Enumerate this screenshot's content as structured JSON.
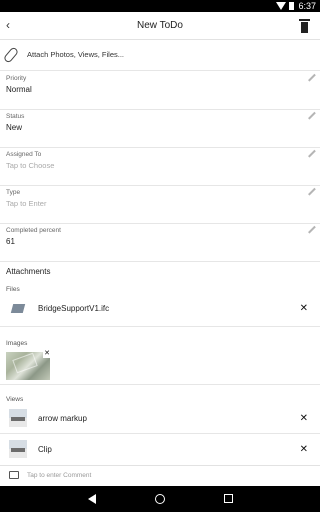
{
  "status_bar": {
    "time": "6:37"
  },
  "header": {
    "title": "New ToDo",
    "back_glyph": "‹"
  },
  "attach": {
    "label": "Attach Photos, Views, Files..."
  },
  "fields": [
    {
      "label": "Priority",
      "value": "Normal",
      "placeholder": false
    },
    {
      "label": "Status",
      "value": "New",
      "placeholder": false
    },
    {
      "label": "Assigned To",
      "value": "Tap to Choose",
      "placeholder": true
    },
    {
      "label": "Type",
      "value": "Tap to Enter",
      "placeholder": true
    },
    {
      "label": "Completed percent",
      "value": "61",
      "placeholder": false
    }
  ],
  "attachments": {
    "title": "Attachments",
    "files_title": "Files",
    "files": [
      {
        "name": "BridgeSupportV1.ifc"
      }
    ],
    "images_title": "Images",
    "views_title": "Views",
    "views": [
      {
        "name": "arrow markup"
      },
      {
        "name": "Clip"
      }
    ]
  },
  "comment": {
    "placeholder": "Tap to enter Comment"
  },
  "close_glyph": "✕"
}
